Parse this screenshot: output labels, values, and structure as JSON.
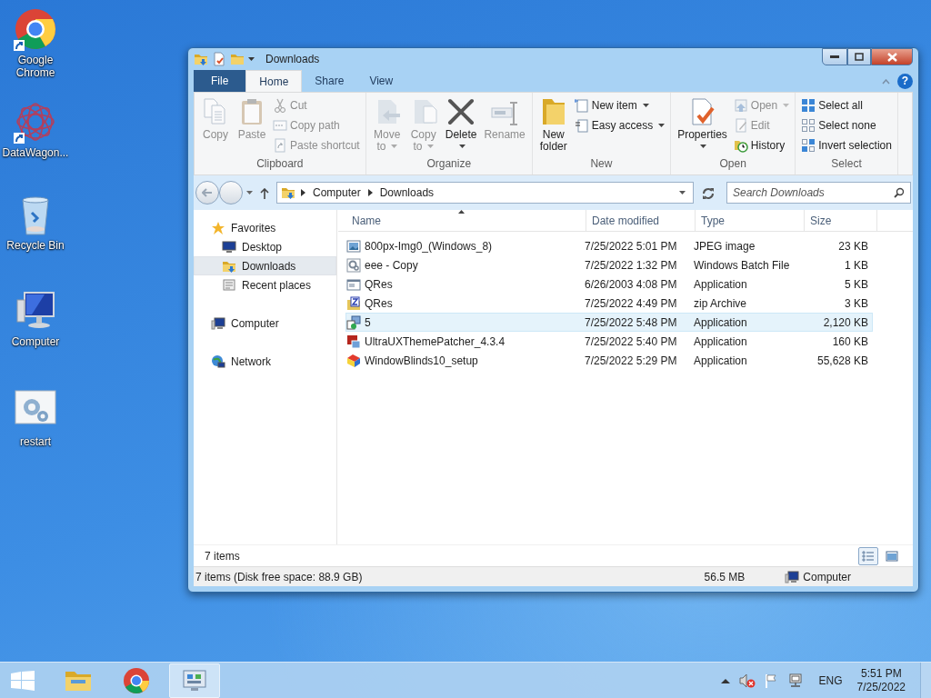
{
  "desktop_icons": [
    {
      "label": "Google Chrome",
      "shortcut": true
    },
    {
      "label": "DataWagon...",
      "shortcut": true
    },
    {
      "label": "Recycle Bin",
      "shortcut": false
    },
    {
      "label": "Computer",
      "shortcut": false
    },
    {
      "label": "restart",
      "shortcut": false
    }
  ],
  "window": {
    "title": "Downloads",
    "tabs": [
      {
        "label": "File",
        "kind": "file",
        "selected": false
      },
      {
        "label": "Home",
        "kind": "tab",
        "selected": true
      },
      {
        "label": "Share",
        "kind": "tab",
        "selected": false
      },
      {
        "label": "View",
        "kind": "tab",
        "selected": false
      }
    ],
    "help_button": "?",
    "ribbon_groups": [
      {
        "label": "Clipboard",
        "items": [
          {
            "label": "Copy",
            "kind": "large",
            "disabled": true,
            "dropdown": false
          },
          {
            "label": "Paste",
            "kind": "large",
            "disabled": true,
            "dropdown": false
          },
          {
            "label": "Cut",
            "kind": "small",
            "disabled": true,
            "dropdown": false
          },
          {
            "label": "Copy path",
            "kind": "small",
            "disabled": true,
            "dropdown": false
          },
          {
            "label": "Paste shortcut",
            "kind": "small",
            "disabled": true,
            "dropdown": false
          }
        ]
      },
      {
        "label": "Organize",
        "items": [
          {
            "label": "Move to",
            "kind": "large",
            "disabled": true,
            "dropdown": true
          },
          {
            "label": "Copy to",
            "kind": "large",
            "disabled": true,
            "dropdown": true
          },
          {
            "label": "Delete",
            "kind": "large",
            "disabled": false,
            "dropdown": true
          },
          {
            "label": "Rename",
            "kind": "large",
            "disabled": true,
            "dropdown": false
          }
        ]
      },
      {
        "label": "New",
        "items": [
          {
            "label": "New folder",
            "kind": "large",
            "disabled": false,
            "dropdown": false
          },
          {
            "label": "New item",
            "kind": "small",
            "disabled": false,
            "dropdown": true
          },
          {
            "label": "Easy access",
            "kind": "small",
            "disabled": false,
            "dropdown": true
          }
        ]
      },
      {
        "label": "Open",
        "items": [
          {
            "label": "Properties",
            "kind": "large",
            "disabled": false,
            "dropdown": true
          },
          {
            "label": "Open",
            "kind": "small",
            "disabled": true,
            "dropdown": true
          },
          {
            "label": "Edit",
            "kind": "small",
            "disabled": true,
            "dropdown": false
          },
          {
            "label": "History",
            "kind": "small",
            "disabled": false,
            "dropdown": false
          }
        ]
      },
      {
        "label": "Select",
        "items": [
          {
            "label": "Select all",
            "kind": "small",
            "disabled": false,
            "dropdown": false
          },
          {
            "label": "Select none",
            "kind": "small",
            "disabled": false,
            "dropdown": false
          },
          {
            "label": "Invert selection",
            "kind": "small",
            "disabled": false,
            "dropdown": false
          }
        ]
      }
    ],
    "breadcrumbs": [
      "Computer",
      "Downloads"
    ],
    "search": {
      "placeholder": "Search Downloads"
    },
    "navigation": [
      {
        "label": "Favorites",
        "selected": false,
        "children": [
          {
            "label": "Desktop",
            "selected": false
          },
          {
            "label": "Downloads",
            "selected": true
          },
          {
            "label": "Recent places",
            "selected": false
          }
        ]
      },
      {
        "label": "Computer",
        "selected": false
      },
      {
        "label": "Network",
        "selected": false
      }
    ],
    "columns": [
      "Name",
      "Date modified",
      "Type",
      "Size"
    ],
    "rows": [
      {
        "name": "800px-Img0_(Windows_8)",
        "date_modified": "7/25/2022 5:01 PM",
        "type": "JPEG image",
        "size": "23 KB",
        "selected": false
      },
      {
        "name": "eee - Copy",
        "date_modified": "7/25/2022 1:32 PM",
        "type": "Windows Batch File",
        "size": "1 KB",
        "selected": false
      },
      {
        "name": "QRes",
        "date_modified": "6/26/2003 4:08 PM",
        "type": "Application",
        "size": "5 KB",
        "selected": false
      },
      {
        "name": "QRes",
        "date_modified": "7/25/2022 4:49 PM",
        "type": "zip Archive",
        "size": "3 KB",
        "selected": false
      },
      {
        "name": "5",
        "date_modified": "7/25/2022 5:48 PM",
        "type": "Application",
        "size": "2,120 KB",
        "selected": true
      },
      {
        "name": "UltraUXThemePatcher_4.3.4",
        "date_modified": "7/25/2022 5:40 PM",
        "type": "Application",
        "size": "160 KB",
        "selected": false
      },
      {
        "name": "WindowBlinds10_setup",
        "date_modified": "7/25/2022 5:29 PM",
        "type": "Application",
        "size": "55,628 KB",
        "selected": false
      }
    ],
    "item_count": "7 items",
    "view_buttons": [
      {
        "kind": "details",
        "selected": true
      },
      {
        "kind": "large_icons",
        "selected": false
      }
    ],
    "status_bar": {
      "summary": "7 items (Disk free space: 88.9 GB)",
      "size": "56.5 MB",
      "location": "Computer"
    }
  },
  "taskbar": {
    "apps": [
      {
        "kind": "explorer",
        "active": false
      },
      {
        "kind": "chrome",
        "active": false
      },
      {
        "kind": "control_panel",
        "active": true
      }
    ],
    "language": "ENG",
    "time": "5:51 PM",
    "date": "7/25/2022"
  }
}
